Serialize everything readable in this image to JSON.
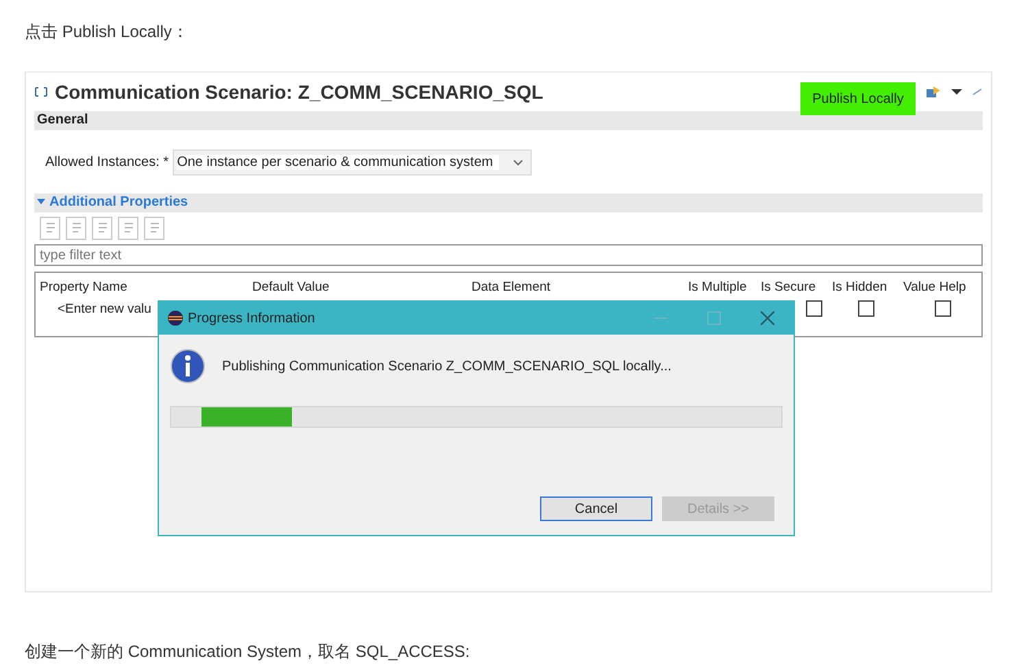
{
  "intro": "点击 Publish Locally：",
  "editor": {
    "title": "Communication Scenario: Z_COMM_SCENARIO_SQL",
    "publish_button": "Publish Locally",
    "general_section": "General",
    "allowed_instances": {
      "label": "Allowed Instances: *",
      "value": "One instance per scenario & communication system"
    },
    "additional_section": "Additional Properties",
    "filter": {
      "placeholder": "type filter text"
    },
    "table": {
      "columns": [
        "Property Name",
        "Default Value",
        "Data Element",
        "Is Multiple",
        "Is Secure",
        "Is Hidden",
        "Value Help"
      ],
      "rows": [
        {
          "property_name": "<Enter new valu",
          "is_secure": false,
          "is_hidden": false,
          "value_help": false
        }
      ]
    }
  },
  "dialog": {
    "title": "Progress Information",
    "message": "Publishing Communication Scenario Z_COMM_SCENARIO_SQL locally...",
    "level": 0.155,
    "buttons": [
      {
        "label": "Cancel",
        "disabled": false
      },
      {
        "label": "Details >>",
        "disabled": true
      }
    ]
  },
  "outro": "创建一个新的 Communication System，取名 SQL_ACCESS:"
}
